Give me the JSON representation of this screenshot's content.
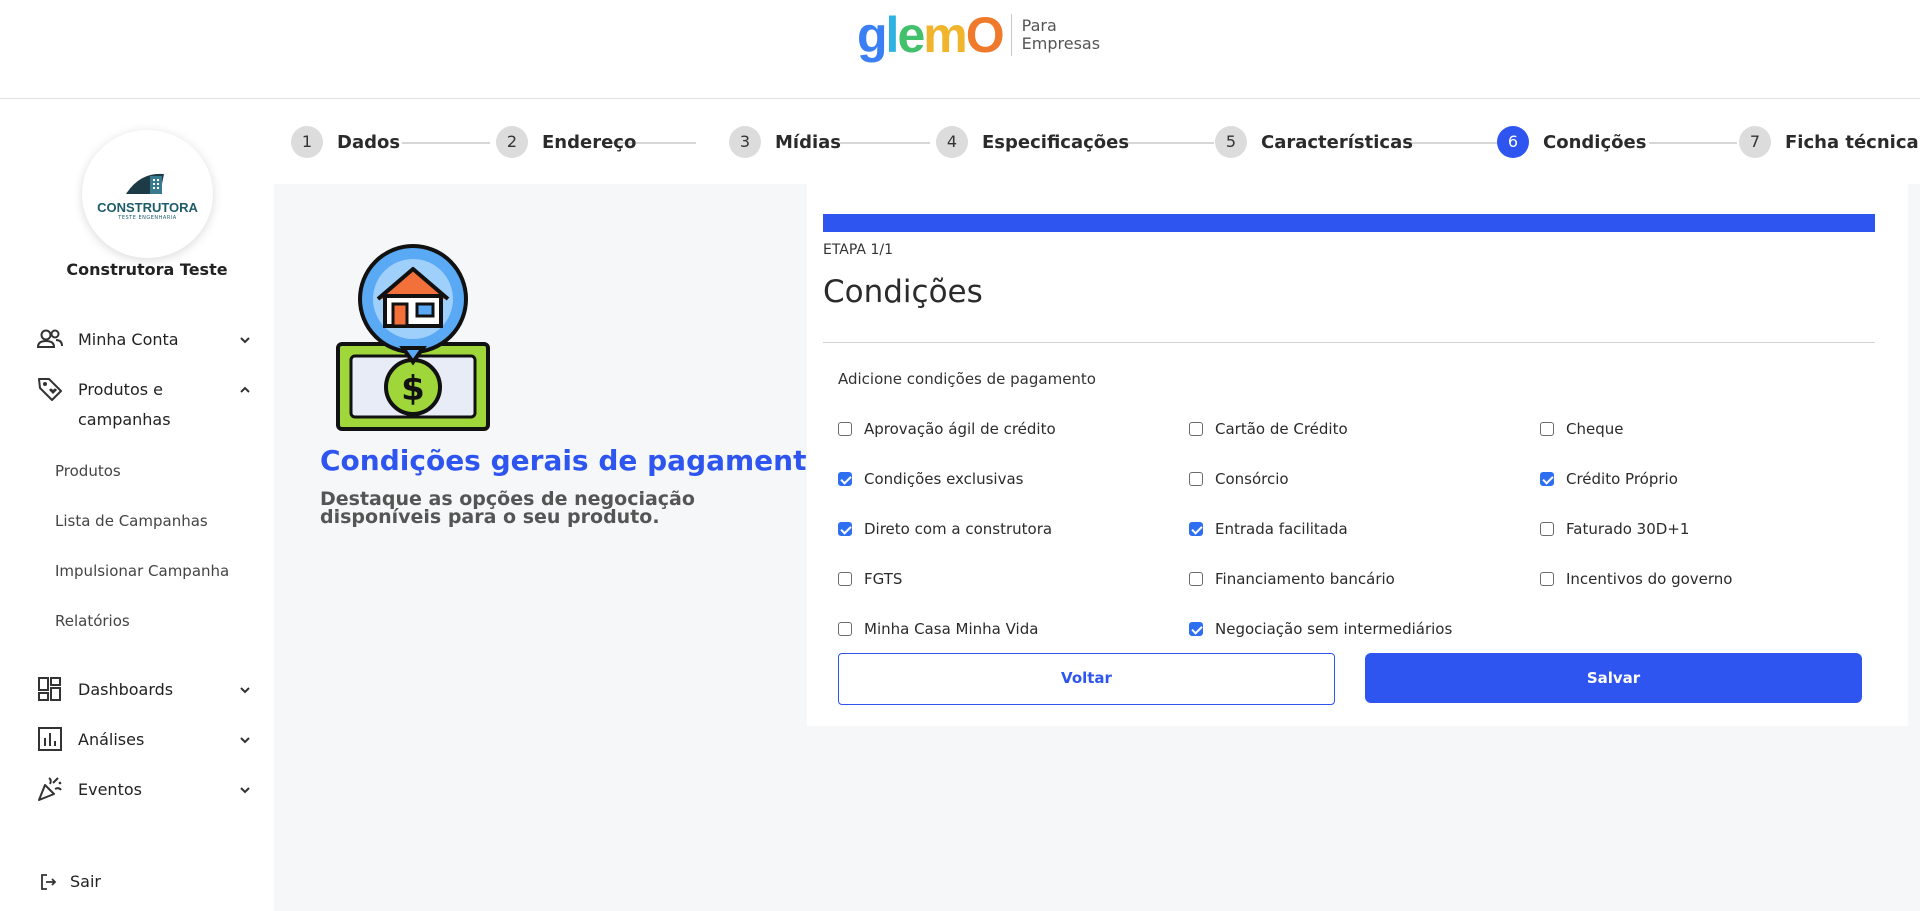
{
  "brand": {
    "logo_g": "g",
    "logo_l": "l",
    "logo_e": "e",
    "logo_m": "m",
    "logo_o": "O",
    "sub_line1": "Para",
    "sub_line2": "Empresas",
    "accent": "#2e55ef"
  },
  "sidebar": {
    "avatar_name": "CONSTRUTORA",
    "avatar_tag": "TESTE ENGENHARIA",
    "company": "Construtora Teste",
    "minha_conta": "Minha Conta",
    "produtos_line1": "Produtos e",
    "produtos_line2": "campanhas",
    "sub_items": [
      "Produtos",
      "Lista de Campanhas",
      "Impulsionar Campanha",
      "Relatórios"
    ],
    "dashboards": "Dashboards",
    "analises": "Análises",
    "eventos": "Eventos",
    "sair": "Sair"
  },
  "stepper": {
    "steps": [
      {
        "num": "1",
        "label": "Dados"
      },
      {
        "num": "2",
        "label": "Endereço"
      },
      {
        "num": "3",
        "label": "Mídias"
      },
      {
        "num": "4",
        "label": "Especificações"
      },
      {
        "num": "5",
        "label": "Características"
      },
      {
        "num": "6",
        "label": "Condições"
      },
      {
        "num": "7",
        "label": "Ficha técnica"
      }
    ],
    "active_index": 6
  },
  "info": {
    "title": "Condições gerais de pagamento",
    "subtitle": "Destaque as opções de negociação disponíveis para o seu produto."
  },
  "form": {
    "etapa": "ETAPA 1/1",
    "progress": 1.0,
    "title": "Condições",
    "section_label": "Adicione condições de pagamento",
    "options": [
      {
        "label": "Aprovação ágil de crédito",
        "checked": false
      },
      {
        "label": "Cartão de Crédito",
        "checked": false
      },
      {
        "label": "Cheque",
        "checked": false
      },
      {
        "label": "Condições exclusivas",
        "checked": true
      },
      {
        "label": "Consórcio",
        "checked": false
      },
      {
        "label": "Crédito Próprio",
        "checked": true
      },
      {
        "label": "Direto com a construtora",
        "checked": true
      },
      {
        "label": "Entrada facilitada",
        "checked": true
      },
      {
        "label": "Faturado 30D+1",
        "checked": false
      },
      {
        "label": "FGTS",
        "checked": false
      },
      {
        "label": "Financiamento bancário",
        "checked": false
      },
      {
        "label": "Incentivos do governo",
        "checked": false
      },
      {
        "label": "Minha Casa Minha Vida",
        "checked": false
      },
      {
        "label": "Negociação sem intermediários",
        "checked": true
      }
    ],
    "back_label": "Voltar",
    "save_label": "Salvar"
  }
}
